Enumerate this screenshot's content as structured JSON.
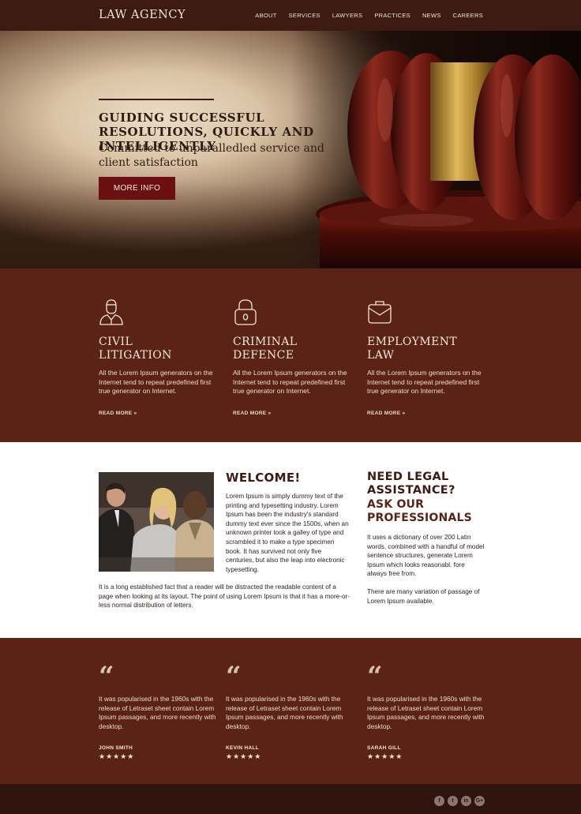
{
  "header": {
    "logo": "LAW AGENCY",
    "nav": [
      "ABOUT",
      "SERVICES",
      "LAWYERS",
      "PRACTICES",
      "NEWS",
      "CAREERS"
    ]
  },
  "hero": {
    "title": "GUIDING SUCCESSFUL RESOLUTIONS, QUICKLY AND INTELLIGENTLY",
    "subtitle": "Committed to unparalledled service and client satisfaction",
    "button": "MORE INFO"
  },
  "services": [
    {
      "icon": "lawyer-person-icon",
      "title_1": "CIVIL",
      "title_2": "LITIGATION",
      "text": "All the Lorem Ipsum generators on the Internet tend to repeat predefined first true generator on Internet.",
      "link": "READ MORE »"
    },
    {
      "icon": "padlock-icon",
      "title_1": "CRIMINAL",
      "title_2": "DEFENCE",
      "text": "All the Lorem Ipsum generators on the Internet tend to repeat predefined first true generator on Internet.",
      "link": "READ MORE »"
    },
    {
      "icon": "briefcase-icon",
      "title_1": "EMPLOYMENT",
      "title_2": "LAW",
      "text": "All the Lorem Ipsum generators on the Internet tend to repeat predefined first true generator on Internet.",
      "link": "READ MORE »"
    }
  ],
  "welcome": {
    "title": "WELCOME!",
    "text": "Lorem Ipsum is simply dummy text of the printing and typesetting industry. Lorem Ipsum has been the industry's standard dummy text ever since the 1500s, when an unknown printer took a galley of type and scrambled it to make a type specimen book. It has survived not only five centuries, but also the leap into electronic typesetting.",
    "text2": "It is a long established fact that a reader will be distracted the readable content of a page when looking at its layout. The point of using Lorem Ipsum is that it has a more-or-less normal distribution of letters."
  },
  "assistance": {
    "title": "NEED LEGAL ASSISTANCE?",
    "subtitle": "ASK OUR PROFESSIONALS",
    "text": "It uses a dictionary of over 200 Latin words, combined with a handful of model sentence structures, generate Lorem Ipsum which looks reasonabl. fore always free from.",
    "text2": "There are many variation of passage of Lorem Ipsum available."
  },
  "testimonials": [
    {
      "quote_mark": "“",
      "text": "It was popularised in the 1960s with the release of Letraset sheet contain Lorem Ipsum passages, and more recently with desktop.",
      "name": "JOHN SMITH",
      "stars": "★★★★★"
    },
    {
      "quote_mark": "“",
      "text": "It was popularised in the 1960s with the release of Letraset sheet contain Lorem Ipsum passages, and more recently with desktop.",
      "name": "KEVIN HALL",
      "stars": "★★★★★"
    },
    {
      "quote_mark": "“",
      "text": "It was popularised in the 1960s with the release of Letraset sheet contain Lorem Ipsum passages, and more recently with desktop.",
      "name": "SARAH GILL",
      "stars": "★★★★★"
    }
  ],
  "footer": {
    "social": [
      {
        "icon": "facebook-icon",
        "glyph": "f"
      },
      {
        "icon": "twitter-icon",
        "glyph": "t"
      },
      {
        "icon": "linkedin-icon",
        "glyph": "in"
      },
      {
        "icon": "google-plus-icon",
        "glyph": "G+"
      }
    ]
  },
  "colors": {
    "brand_dark": "#3d1a12",
    "section_brown": "#5a2316",
    "button_red": "#6b0f12",
    "footer": "#2f140d"
  }
}
